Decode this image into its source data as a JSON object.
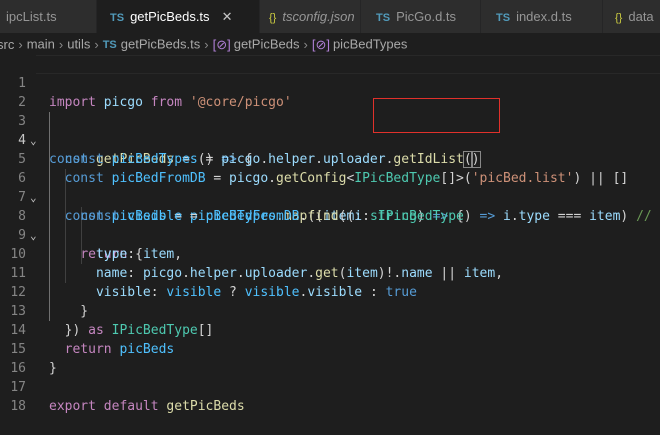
{
  "tabs": [
    {
      "label": "ipcList.ts",
      "icon": "ts-file-icon",
      "icon_text": "TS",
      "active": false
    },
    {
      "label": "getPicBeds.ts",
      "icon": "ts-file-icon",
      "icon_text": "TS",
      "active": true,
      "close": "✕"
    },
    {
      "label": "tsconfig.json",
      "icon": "json-file-icon",
      "icon_text": "{}",
      "active": false
    },
    {
      "label": "PicGo.d.ts",
      "icon": "ts-file-icon",
      "icon_text": "TS",
      "active": false
    },
    {
      "label": "index.d.ts",
      "icon": "ts-file-icon",
      "icon_text": "TS",
      "active": false
    },
    {
      "label": "data",
      "icon": "json-file-icon",
      "icon_text": "{}",
      "active": false
    }
  ],
  "breadcrumb": {
    "parts": [
      "src",
      "main",
      "utils",
      "getPicBeds.ts",
      "getPicBeds",
      "picBedTypes"
    ],
    "file_icon_text": "TS"
  },
  "editor": {
    "current_line": 4,
    "line_numbers": [
      "1",
      "2",
      "3",
      "4",
      "5",
      "6",
      "7",
      "8",
      "9",
      "10",
      "11",
      "12",
      "13",
      "14",
      "15",
      "16",
      "17",
      "18"
    ],
    "lines": [
      "import picgo from '@core/picgo'",
      "",
      "const getPicBeds = () => {",
      "  const picBedTypes = picgo.helper.uploader.getIdList()",
      "  const picBedFromDB = picgo.getConfig<IPicBedType[]>('picBed.list') || []",
      "  const picBeds = picBedTypes.map((item: string) => {",
      "    const visible = picBedFromDB.find((i: IPicBedType) => i.type === item) // o",
      "    return {",
      "      type: item,",
      "      name: picgo.helper.uploader.get(item)!.name || item,",
      "      visible: visible ? visible.visible : true",
      "    }",
      "  }) as IPicBedType[]",
      "  return picBeds",
      "}",
      "",
      "export default getPicBeds",
      ""
    ],
    "highlight_box_color": "#e0312b"
  }
}
